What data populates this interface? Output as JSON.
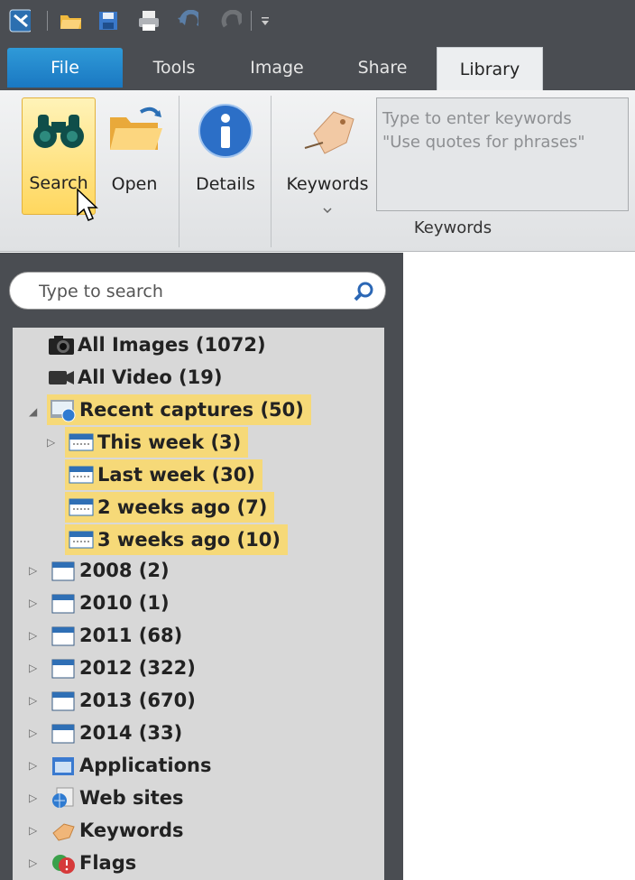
{
  "tabs": {
    "file": "File",
    "tools": "Tools",
    "image": "Image",
    "share": "Share",
    "library": "Library"
  },
  "ribbon": {
    "search": "Search",
    "open": "Open",
    "details": "Details",
    "keywords": "Keywords",
    "keyword_box_line1": "Type to enter keywords",
    "keyword_box_line2": "\"Use quotes for phrases\"",
    "group_label": "Keywords"
  },
  "search": {
    "placeholder": "Type to search"
  },
  "tree": {
    "all_images": "All Images (1072)",
    "all_video": "All Video (19)",
    "recent": "Recent captures (50)",
    "this_week": "This week (3)",
    "last_week": "Last week (30)",
    "two_weeks": "2 weeks ago (7)",
    "three_weeks": "3 weeks ago (10)",
    "y2008": "2008 (2)",
    "y2010": "2010 (1)",
    "y2011": "2011 (68)",
    "y2012": "2012 (322)",
    "y2013": "2013 (670)",
    "y2014": "2014 (33)",
    "applications": "Applications",
    "websites": "Web sites",
    "keywords": "Keywords",
    "flags": "Flags"
  },
  "colors": {
    "accent": "#1a78c2",
    "highlight": "#f6d978",
    "chrome": "#4a4d52"
  }
}
